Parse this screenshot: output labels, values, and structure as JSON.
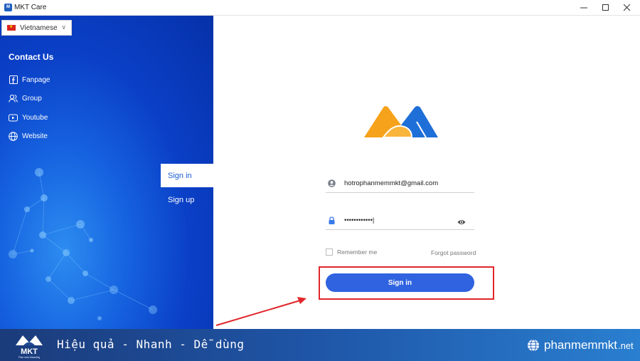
{
  "window": {
    "title": "MKT Care",
    "icon_label": "M"
  },
  "language": {
    "selected": "Vietnamese"
  },
  "contact": {
    "title": "Contact Us",
    "items": [
      {
        "label": "Fanpage",
        "icon": "facebook-icon"
      },
      {
        "label": "Group",
        "icon": "group-icon"
      },
      {
        "label": "Youtube",
        "icon": "youtube-icon"
      },
      {
        "label": "Website",
        "icon": "globe-icon"
      }
    ]
  },
  "tabs": [
    {
      "label": "Sign in",
      "active": true
    },
    {
      "label": "Sign up",
      "active": false
    }
  ],
  "form": {
    "email_value": "hotrophanmemmkt@gmail.com",
    "password_value": "••••••••••••|",
    "remember_label": "Remember me",
    "forgot_label": "Forgot password",
    "signin_label": "Sign in"
  },
  "banner": {
    "logo_text": "MKT",
    "logo_subtext": "Phần mềm Marketing",
    "slogan": "Hiệu quả - Nhanh  - Dễ dùng",
    "site_main": "phanmemmkt",
    "site_tld": ".net"
  },
  "colors": {
    "accent_blue": "#2f63e0",
    "highlight_red": "#e0262b",
    "panel_blue": "#0a3fc6",
    "logo_orange": "#f6a21a",
    "logo_blue": "#1f6fd8"
  }
}
